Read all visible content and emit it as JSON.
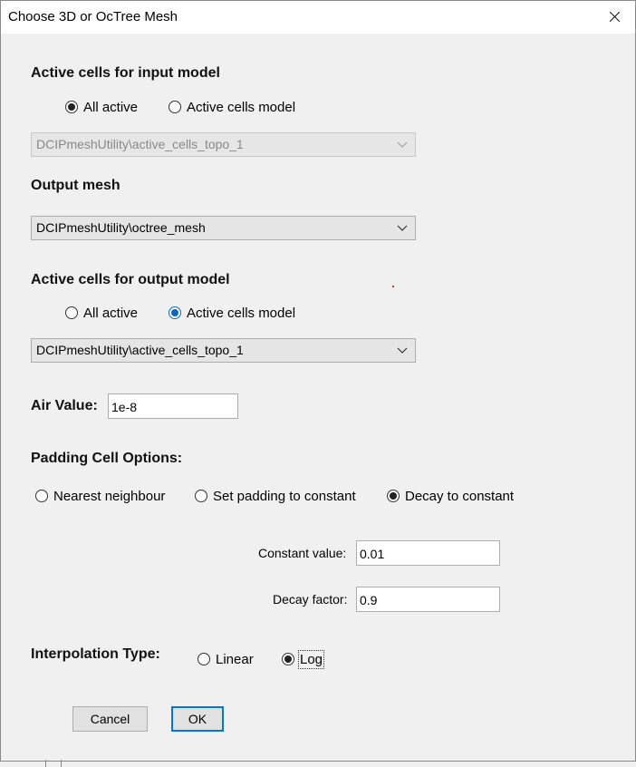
{
  "window": {
    "title": "Choose 3D or OcTree Mesh"
  },
  "input_active": {
    "heading": "Active cells for input model",
    "option_all": "All active",
    "option_model": "Active cells model",
    "selected": "All active",
    "dropdown_value": "DCIPmeshUtility\\active_cells_topo_1"
  },
  "output_mesh": {
    "heading": "Output mesh",
    "dropdown_value": "DCIPmeshUtility\\octree_mesh"
  },
  "output_active": {
    "heading": "Active cells for output model",
    "option_all": "All active",
    "option_model": "Active cells model",
    "selected": "Active cells model",
    "dropdown_value": "DCIPmeshUtility\\active_cells_topo_1"
  },
  "air": {
    "label": "Air Value:",
    "value": "1e-8"
  },
  "padding": {
    "heading": "Padding Cell Options:",
    "option_nearest": "Nearest neighbour",
    "option_set": "Set padding to constant",
    "option_decay": "Decay to constant",
    "selected": "Decay to constant",
    "constant_label": "Constant value:",
    "constant_value": "0.01",
    "decay_label": "Decay factor:",
    "decay_value": "0.9"
  },
  "interpolation": {
    "label": "Interpolation Type:",
    "option_linear": "Linear",
    "option_log": "Log",
    "selected": "Log"
  },
  "buttons": {
    "cancel": "Cancel",
    "ok": "OK"
  },
  "colors": {
    "accent": "#0078d7",
    "radio_selected_blue": "#0a64c8"
  }
}
